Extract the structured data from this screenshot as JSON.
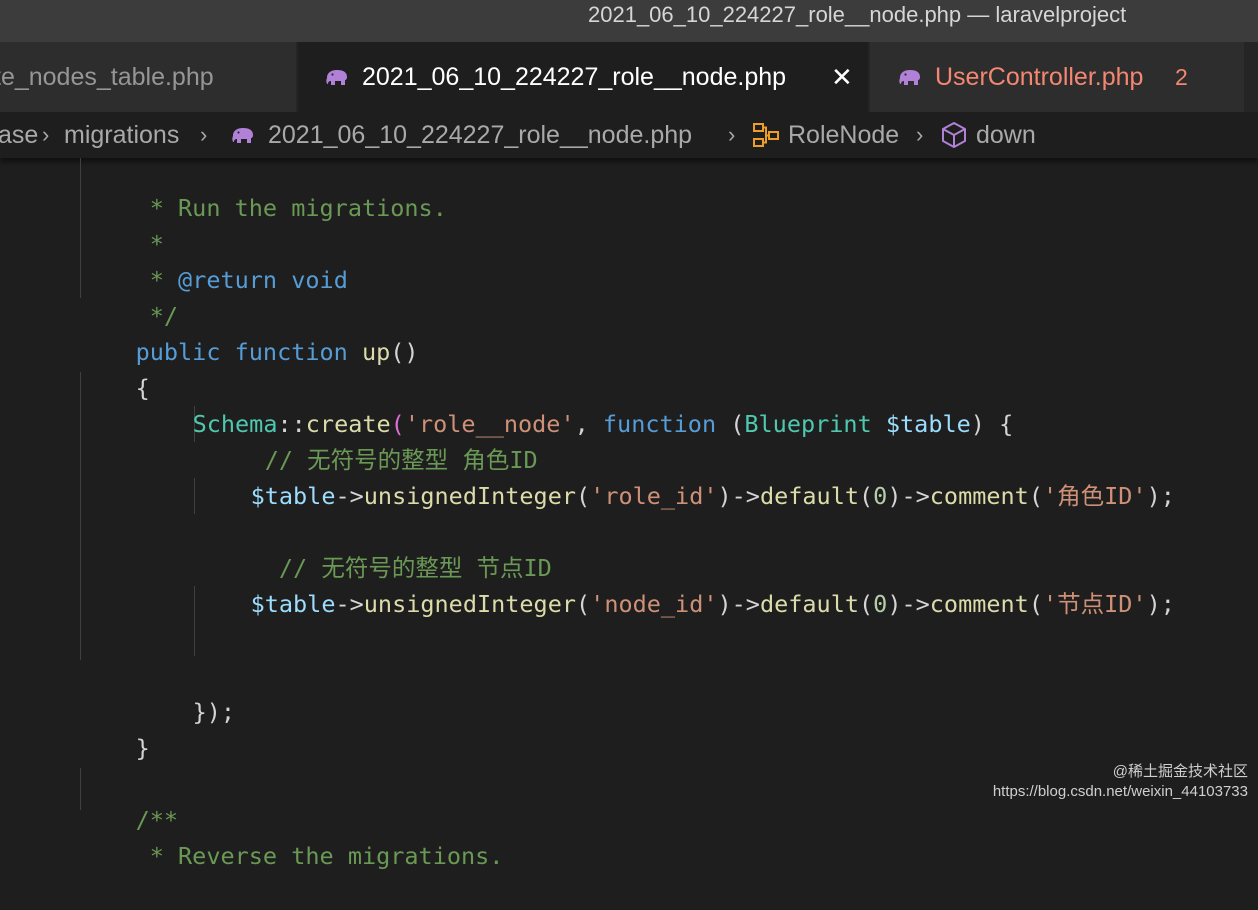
{
  "window": {
    "title": "2021_06_10_224227_role__node.php — laravelproject"
  },
  "tabs": [
    {
      "label": "te_nodes_table.php",
      "active": false
    },
    {
      "label": "2021_06_10_224227_role__node.php",
      "active": true,
      "close": "✕"
    },
    {
      "label": "UserController.php",
      "active": false,
      "problems": "2"
    }
  ],
  "breadcrumb": {
    "items": [
      "ase",
      "migrations",
      "2021_06_10_224227_role__node.php",
      "RoleNode",
      "down"
    ],
    "separator": "›"
  },
  "code": {
    "l1": {
      "t1": " * Run the migrations."
    },
    "l2": {
      "t1": " *"
    },
    "l3": {
      "t1": " * ",
      "t2": "@return",
      "t3": " ",
      "t4": "void"
    },
    "l4": {
      "t1": " */"
    },
    "l5": {
      "t1": "public",
      "t2": " ",
      "t3": "function",
      "t4": " ",
      "t5": "up",
      "t6": "()"
    },
    "l6": {
      "t1": "{"
    },
    "l7": {
      "t1": "Schema",
      "t2": "::",
      "t3": "create",
      "t4": "(",
      "t5": "'role__node'",
      "t6": ", ",
      "t7": "function",
      "t8": " (",
      "t9": "Blueprint",
      "t10": " ",
      "t11": "$table",
      "t12": ") ",
      "t13": "{"
    },
    "l8": {
      "t1": " // 无符号的整型 角色ID"
    },
    "l9": {
      "t1": "$table",
      "t2": "->",
      "t3": "unsignedInteger",
      "t4": "(",
      "t5": "'role_id'",
      "t6": ")->",
      "t7": "default",
      "t8": "(",
      "t9": "0",
      "t10": ")->",
      "t11": "comment",
      "t12": "(",
      "t13": "'角色ID'",
      "t14": ");"
    },
    "l10": {
      "t1": "  // 无符号的整型 节点ID"
    },
    "l11": {
      "t1": "$table",
      "t2": "->",
      "t3": "unsignedInteger",
      "t4": "(",
      "t5": "'node_id'",
      "t6": ")->",
      "t7": "default",
      "t8": "(",
      "t9": "0",
      "t10": ")->",
      "t11": "comment",
      "t12": "(",
      "t13": "'节点ID'",
      "t14": ");"
    },
    "l12": {
      "t1": "}",
      "t2": ");"
    },
    "l13": {
      "t1": "}"
    },
    "l14": {
      "t1": "/**"
    },
    "l15": {
      "t1": " * Reverse the migrations."
    }
  },
  "watermark": {
    "line1": "@稀土掘金技术社区",
    "line2": "https://blog.csdn.net/weixin_44103733"
  },
  "colors": {
    "editor_bg": "#1e1e1e",
    "comment": "#6a9955",
    "keyword": "#569cd6",
    "function": "#dcdcaa",
    "class": "#4ec9b0",
    "variable": "#9cdcfe",
    "string": "#ce9178",
    "number": "#b5cea8",
    "error": "#f48771",
    "php_icon": "#b180d7"
  },
  "icons": [
    "php-elephant-icon",
    "close-icon",
    "chevron-right-icon",
    "class-icon",
    "method-cube-icon"
  ]
}
